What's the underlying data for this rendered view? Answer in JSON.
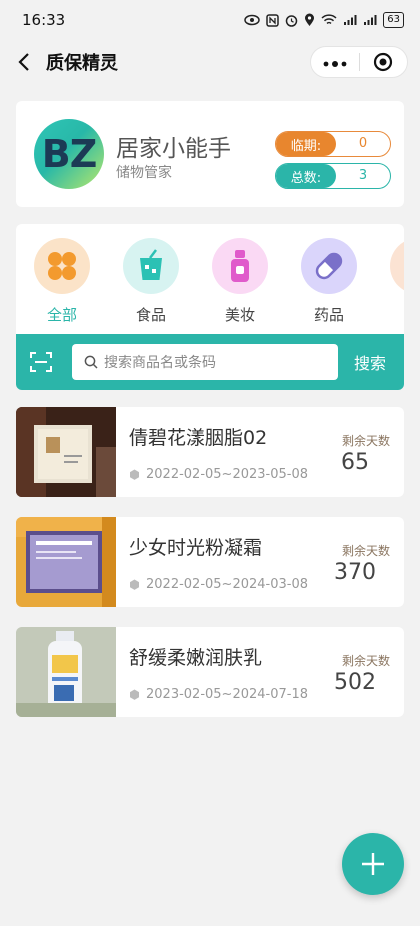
{
  "status": {
    "time": "16:33",
    "network": "4G 4G",
    "battery": "63"
  },
  "nav": {
    "title": "质保精灵"
  },
  "profile": {
    "avatar_text": "BZ",
    "name": "居家小能手",
    "subtitle": "储物管家",
    "expire_label": "临期:",
    "expire_value": "0",
    "total_label": "总数:",
    "total_value": "3"
  },
  "categories": [
    {
      "label": "全部",
      "icon": "grid-icon",
      "active": true
    },
    {
      "label": "食品",
      "icon": "drink-cup-icon",
      "active": false
    },
    {
      "label": "美妆",
      "icon": "cosmetic-bottle-icon",
      "active": false
    },
    {
      "label": "药品",
      "icon": "pill-icon",
      "active": false
    }
  ],
  "search": {
    "placeholder": "搜索商品名或条码",
    "button": "搜索"
  },
  "items": [
    {
      "name": "倩碧花漾胭脂02",
      "date_range": "2022-02-05~2023-05-08",
      "days_label": "剩余天数",
      "days": "65"
    },
    {
      "name": "少女时光粉凝霜",
      "date_range": "2022-02-05~2024-03-08",
      "days_label": "剩余天数",
      "days": "370"
    },
    {
      "name": "舒缓柔嫩润肤乳",
      "date_range": "2023-02-05~2024-07-18",
      "days_label": "剩余天数",
      "days": "502"
    }
  ],
  "colors": {
    "accent": "#2bb5a9",
    "warning": "#e8862e"
  }
}
